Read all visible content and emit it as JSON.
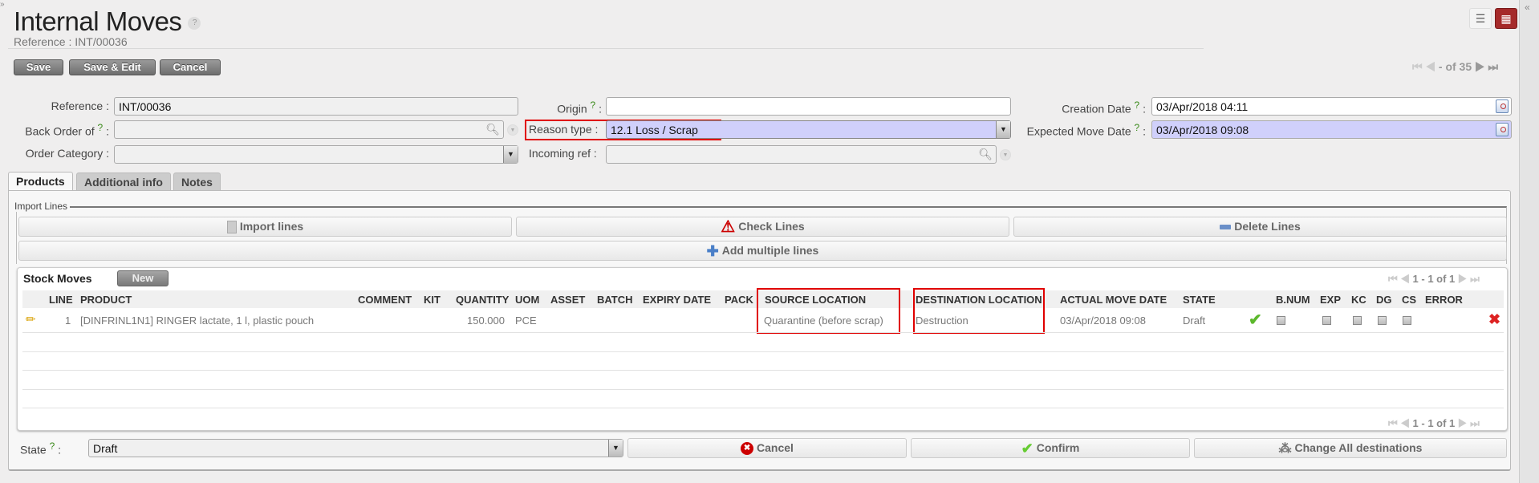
{
  "header": {
    "title": "Internal Moves",
    "help": "?",
    "subtitle": "Reference : INT/00036"
  },
  "toolbar": {
    "save": "Save",
    "save_edit": "Save & Edit",
    "cancel": "Cancel"
  },
  "pager": {
    "text": "- of 35"
  },
  "form": {
    "reference": {
      "label": "Reference :",
      "value": "INT/00036"
    },
    "back_order": {
      "label": "Back Order of",
      "help": "?",
      "colon": ":",
      "value": ""
    },
    "order_category": {
      "label": "Order Category :",
      "value": ""
    },
    "origin": {
      "label": "Origin",
      "help": "?",
      "colon": ":",
      "value": ""
    },
    "reason_type": {
      "label": "Reason type :",
      "value": "12.1 Loss / Scrap"
    },
    "incoming_ref": {
      "label": "Incoming ref :",
      "value": ""
    },
    "creation_date": {
      "label": "Creation Date",
      "help": "?",
      "colon": ":",
      "value": "03/Apr/2018 04:11"
    },
    "expected_move_date": {
      "label": "Expected Move Date",
      "help": "?",
      "colon": ":",
      "value": "03/Apr/2018 09:08"
    }
  },
  "tabs": [
    "Products",
    "Additional info",
    "Notes"
  ],
  "import_lines": {
    "legend": "Import Lines",
    "import": "Import lines",
    "check": "Check Lines",
    "delete": "Delete Lines",
    "add_multiple": "Add multiple lines"
  },
  "stock_moves": {
    "title": "Stock Moves",
    "new": "New",
    "pager": "1 - 1 of 1",
    "columns": [
      "LINE",
      "PRODUCT",
      "COMMENT",
      "KIT",
      "QUANTITY",
      "UOM",
      "ASSET",
      "BATCH",
      "EXPIRY DATE",
      "PACK",
      "SOURCE LOCATION",
      "DESTINATION LOCATION",
      "ACTUAL MOVE DATE",
      "STATE",
      "B.NUM",
      "EXP",
      "KC",
      "DG",
      "CS",
      "ERROR"
    ],
    "rows": [
      {
        "line": "1",
        "product": "[DINFRINL1N1] RINGER lactate, 1 l, plastic pouch",
        "quantity": "150.000",
        "uom": "PCE",
        "source": "Quarantine (before scrap)",
        "destination": "Destruction",
        "actual_date": "03/Apr/2018 09:08",
        "state": "Draft"
      }
    ]
  },
  "footer": {
    "state_label": "State",
    "state_help": "?",
    "state_colon": ":",
    "state_value": "Draft",
    "cancel": "Cancel",
    "confirm": "Confirm",
    "change_all": "Change All destinations"
  },
  "colors": {
    "highlight": "#e00000",
    "required_field": "#d0d0fb",
    "active_view": "#a52a2a"
  }
}
